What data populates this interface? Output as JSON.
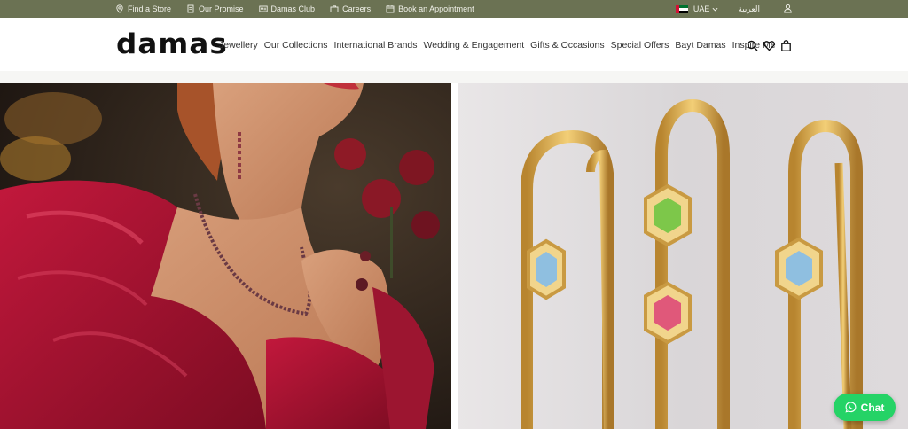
{
  "topbar": {
    "links": [
      {
        "label": "Find a Store",
        "icon": "location-pin-icon"
      },
      {
        "label": "Our Promise",
        "icon": "document-icon"
      },
      {
        "label": "Damas Club",
        "icon": "member-card-icon"
      },
      {
        "label": "Careers",
        "icon": "briefcase-icon"
      },
      {
        "label": "Book an Appointment",
        "icon": "calendar-icon"
      }
    ],
    "country": "UAE",
    "language": "العربية",
    "background": "#6b7253"
  },
  "header": {
    "logo": "damas",
    "nav": [
      "Jewellery",
      "Our Collections",
      "International Brands",
      "Wedding & Engagement",
      "Gifts & Occasions",
      "Special Offers",
      "Bayt Damas",
      "Inspire Me"
    ],
    "icons": [
      "search-icon",
      "heart-icon",
      "shopping-bag-icon"
    ]
  },
  "chat": {
    "label": "Chat",
    "color": "#25d366"
  }
}
